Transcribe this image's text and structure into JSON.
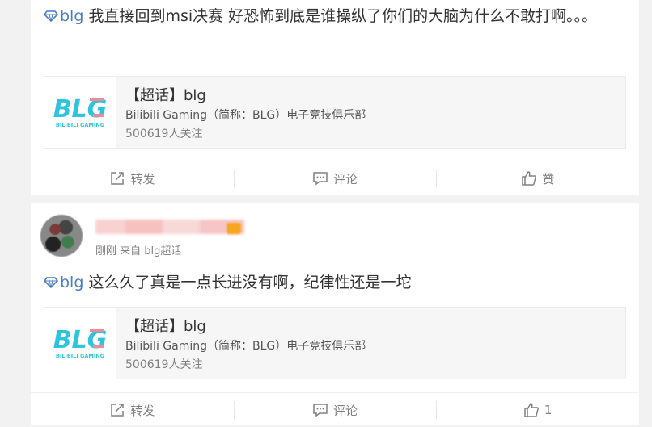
{
  "colors": {
    "topic_blue": "#4a7fbf",
    "diamond": "#4a7fbf",
    "action_gray": "#808080",
    "logo_cyan": "#2ec4de",
    "logo_pink": "#e88d9f"
  },
  "posts": [
    {
      "topic_tag": "blg",
      "text": "我直接回到msi决赛 好恐怖到底是谁操纵了你们的大脑为什么不敢打啊。。。",
      "ref": {
        "title": "【超话】blg",
        "desc": "Bilibili Gaming（简称：BLG）电子竞技俱乐部",
        "count": "500619人关注",
        "logo_text": "BLG",
        "logo_sub": "BILIBILI GAMING"
      },
      "actions": {
        "repost": "转发",
        "comment": "评论",
        "like": "赞"
      }
    },
    {
      "meta": "刚刚 来自 blg超话",
      "topic_tag": "blg",
      "text": "这么久了真是一点长进没有啊，纪律性还是一坨",
      "ref": {
        "title": "【超话】blg",
        "desc": "Bilibili Gaming（简称：BLG）电子竞技俱乐部",
        "count": "500619人关注",
        "logo_text": "BLG",
        "logo_sub": "BILIBILI GAMING"
      },
      "actions": {
        "repost": "转发",
        "comment": "评论",
        "like": "1"
      }
    }
  ]
}
